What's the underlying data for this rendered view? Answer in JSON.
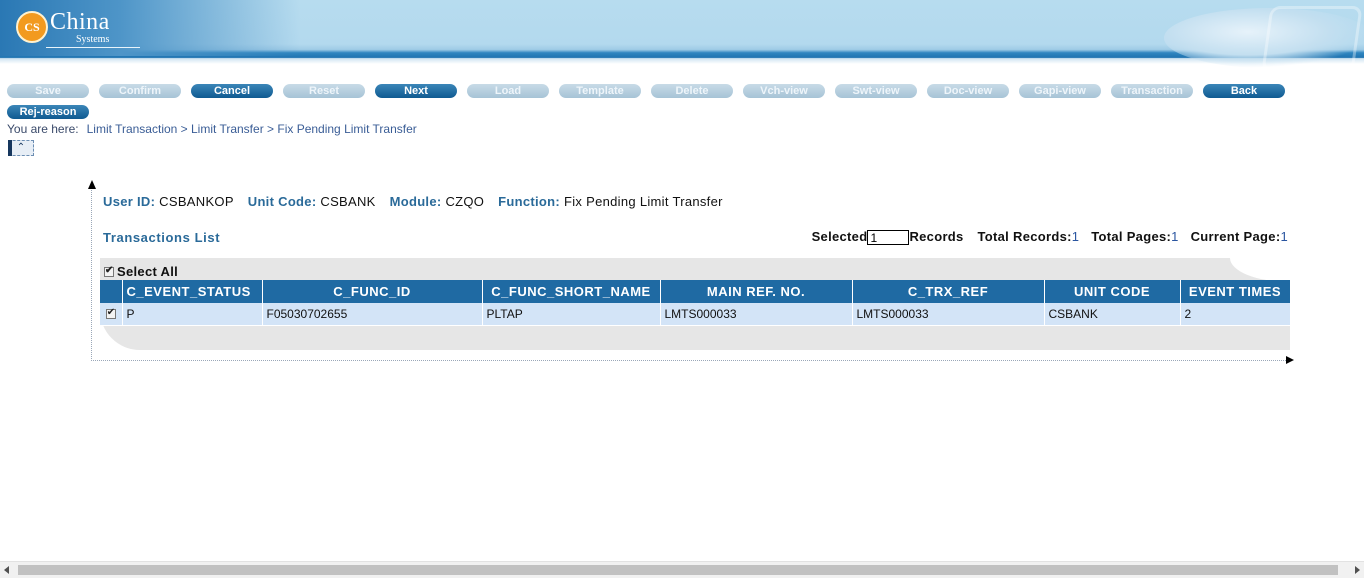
{
  "header": {
    "logo_badge": "CS",
    "logo_name": "China",
    "logo_sub": "Systems"
  },
  "toolbar": [
    {
      "label": "Save",
      "enabled": false
    },
    {
      "label": "Confirm",
      "enabled": false
    },
    {
      "label": "Cancel",
      "enabled": true
    },
    {
      "label": "Reset",
      "enabled": false
    },
    {
      "label": "Next",
      "enabled": true
    },
    {
      "label": "Load",
      "enabled": false
    },
    {
      "label": "Template",
      "enabled": false
    },
    {
      "label": "Delete",
      "enabled": false
    },
    {
      "label": "Vch-view",
      "enabled": false
    },
    {
      "label": "Swt-view",
      "enabled": false
    },
    {
      "label": "Doc-view",
      "enabled": false
    },
    {
      "label": "Gapi-view",
      "enabled": false
    },
    {
      "label": "Transaction",
      "enabled": false
    },
    {
      "label": "Back",
      "enabled": true
    },
    {
      "label": "Rej-reason",
      "enabled": true
    }
  ],
  "breadcrumb": {
    "label": "You are here:",
    "path": "Limit Transaction > Limit Transfer > Fix Pending Limit Transfer"
  },
  "collapse_glyph": "⌃",
  "info": {
    "user_id_label": "User ID:",
    "user_id": "CSBANKOP",
    "unit_code_label": "Unit Code:",
    "unit_code": "CSBANK",
    "module_label": "Module:",
    "module": "CZQO",
    "function_label": "Function:",
    "function": "Fix Pending Limit Transfer"
  },
  "list": {
    "title": "Transactions List",
    "selected_label": "Selected",
    "selected_value": "1",
    "records_label": "Records",
    "total_records_label": "Total Records:",
    "total_records": "1",
    "total_pages_label": "Total Pages:",
    "total_pages": "1",
    "current_page_label": "Current Page:",
    "current_page": "1",
    "select_all_label": "Select All",
    "columns": [
      "C_EVENT_STATUS",
      "C_FUNC_ID",
      "C_FUNC_SHORT_NAME",
      "MAIN REF. NO.",
      "C_TRX_REF",
      "UNIT CODE",
      "EVENT TIMES"
    ],
    "rows": [
      [
        "P",
        "F05030702655",
        "PLTAP",
        "LMTS000033",
        "LMTS000033",
        "CSBANK",
        "2"
      ]
    ]
  }
}
